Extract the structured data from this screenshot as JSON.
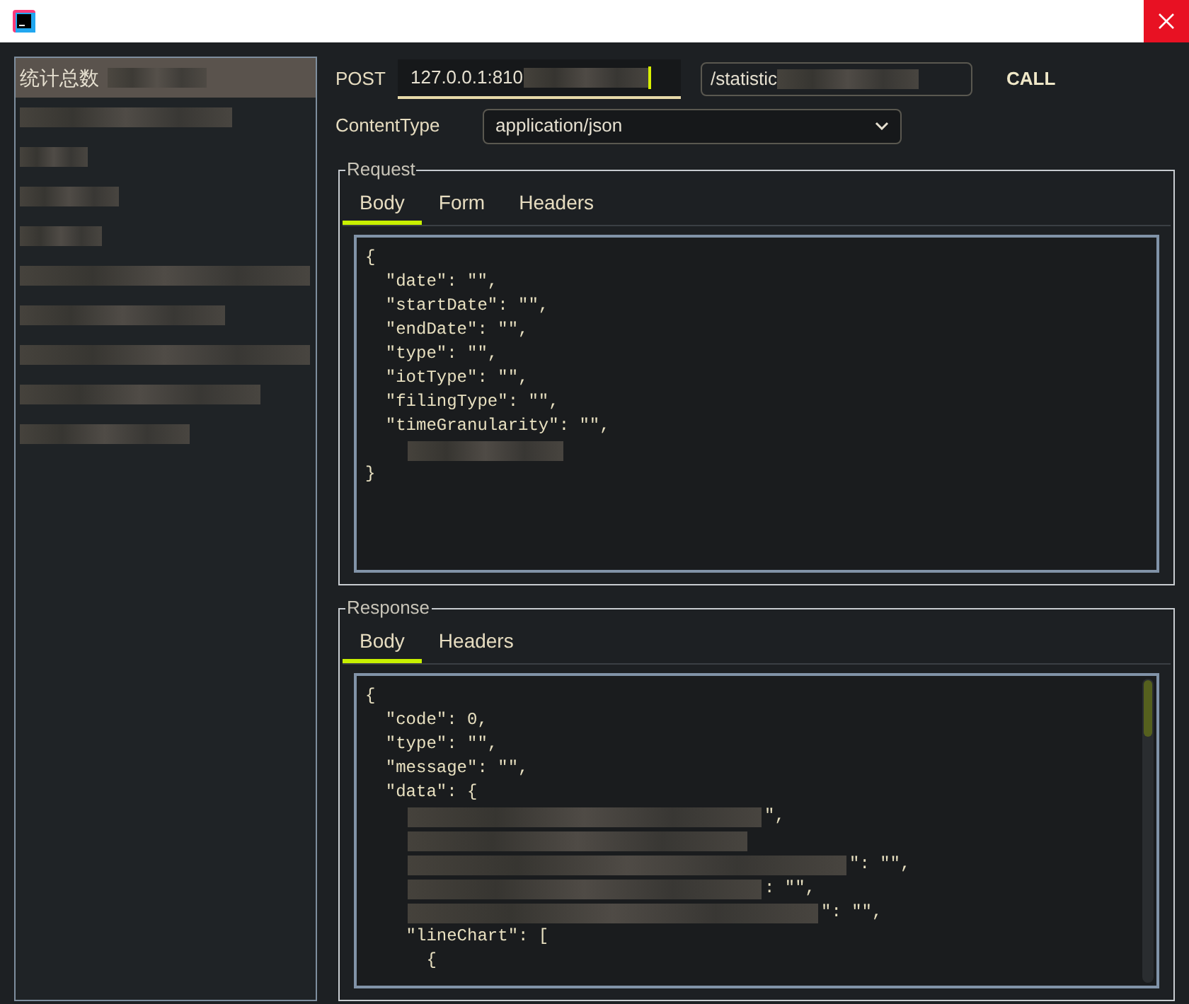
{
  "sidebar": {
    "items": [
      {
        "label": "统计总数",
        "selected": true,
        "blurred": true
      },
      {
        "selected": false,
        "blurred": true
      },
      {
        "selected": false,
        "blurred": true
      },
      {
        "selected": false,
        "blurred": true
      },
      {
        "selected": false,
        "blurred": true
      },
      {
        "selected": false,
        "blurred": true
      },
      {
        "selected": false,
        "blurred": true
      },
      {
        "selected": false,
        "blurred": true
      },
      {
        "selected": false,
        "blurred": true
      },
      {
        "selected": false,
        "blurred": true
      }
    ]
  },
  "request_line": {
    "method": "POST",
    "host": {
      "value": "127.0.0.1:810",
      "blurred": true
    },
    "path": {
      "value": "/statistic",
      "blurred": true
    },
    "call": "CALL"
  },
  "content_type": {
    "label": "ContentType",
    "value": "application/json"
  },
  "request": {
    "title": "Request",
    "tabs": [
      {
        "label": "Body",
        "selected": true
      },
      {
        "label": "Form",
        "selected": false
      },
      {
        "label": "Headers",
        "selected": false
      }
    ],
    "lines": [
      {
        "kind": "text",
        "text": "{"
      },
      {
        "kind": "text",
        "text": "  \"date\": \"\","
      },
      {
        "kind": "text",
        "text": "  \"startDate\": \"\","
      },
      {
        "kind": "text",
        "text": "  \"endDate\": \"\","
      },
      {
        "kind": "text",
        "text": "  \"type\": \"\","
      },
      {
        "kind": "text",
        "text": "  \"iotType\": \"\","
      },
      {
        "kind": "text",
        "text": "  \"filingType\": \"\","
      },
      {
        "kind": "text",
        "text": "  \"timeGranularity\": \"\","
      },
      {
        "kind": "blurred"
      },
      {
        "kind": "text",
        "text": "}"
      }
    ]
  },
  "response": {
    "title": "Response",
    "tabs": [
      {
        "label": "Body",
        "selected": true
      },
      {
        "label": "Headers",
        "selected": false
      }
    ],
    "lines": [
      {
        "kind": "text",
        "text": "{"
      },
      {
        "kind": "text",
        "text": "  \"code\": 0,"
      },
      {
        "kind": "text",
        "text": "  \"type\": \"\","
      },
      {
        "kind": "text",
        "text": "  \"message\": \"\","
      },
      {
        "kind": "text",
        "text": "  \"data\": {"
      },
      {
        "kind": "blurred",
        "tail": "\","
      },
      {
        "kind": "blurred"
      },
      {
        "kind": "blurred",
        "tail": "\": \"\","
      },
      {
        "kind": "blurred",
        "tail": ": \"\","
      },
      {
        "kind": "blurred",
        "tail": "\": \"\","
      },
      {
        "kind": "text",
        "text": "    \"lineChart\": ["
      },
      {
        "kind": "text",
        "text": "      {"
      }
    ]
  }
}
